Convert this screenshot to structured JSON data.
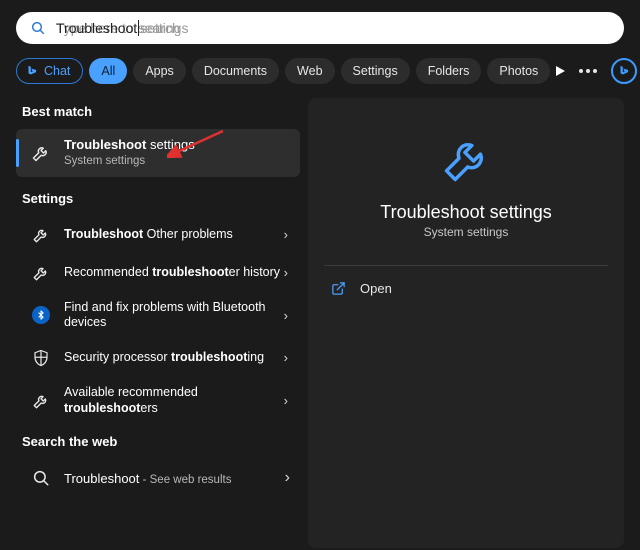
{
  "search": {
    "typed": "Troubleshoot",
    "ghost": " settings",
    "placeholder": "Type here to search"
  },
  "filters": {
    "chat": "Chat",
    "all": "All",
    "apps": "Apps",
    "documents": "Documents",
    "web": "Web",
    "settings": "Settings",
    "folders": "Folders",
    "photos": "Photos"
  },
  "sections": {
    "best_match": "Best match",
    "settings": "Settings",
    "search_web": "Search the web"
  },
  "best_match": {
    "title_bold": "Troubleshoot",
    "title_rest": " settings",
    "subtitle": "System settings"
  },
  "settings_items": [
    {
      "bold": "Troubleshoot",
      "rest": " Other problems",
      "icon": "wrench"
    },
    {
      "pre": "Recommended ",
      "bold": "troubleshoot",
      "post": "er history",
      "icon": "wrench"
    },
    {
      "pre": "Find and fix problems with Bluetooth devices",
      "bold": "",
      "post": "",
      "icon": "bluetooth"
    },
    {
      "pre": "Security processor ",
      "bold": "troubleshoot",
      "post": "ing",
      "icon": "shield"
    },
    {
      "pre": "Available recommended ",
      "bold": "troubleshoot",
      "post": "ers",
      "icon": "wrench"
    }
  ],
  "web": {
    "title": "Troubleshoot",
    "suffix": " - See web results"
  },
  "preview": {
    "title": "Troubleshoot settings",
    "subtitle": "System settings",
    "open_label": "Open"
  },
  "colors": {
    "accent": "#4aa0ff"
  }
}
